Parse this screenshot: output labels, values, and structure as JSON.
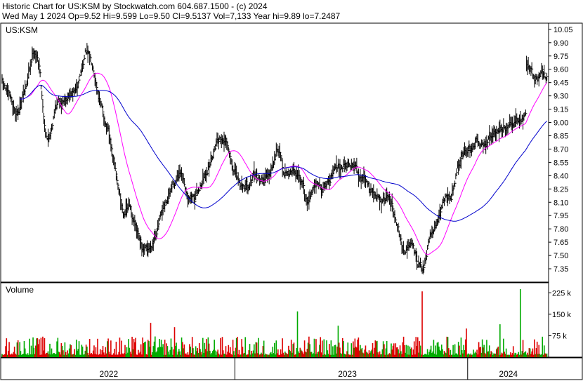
{
  "header": {
    "line1": "Historic Chart for US:KSM by Stockwatch.com 604.687.1500 - (c) 2024",
    "line2": "Wed May  1 2024   Op=9.52  Hi=9.599  Lo=9.50  Cl=9.5137  Vol=7,133  Year hi=9.89  lo=7.2487"
  },
  "chart_data": {
    "type": "line",
    "symbol": "US:KSM",
    "price_axis": {
      "ylim": [
        7.2,
        10.12
      ],
      "ticks": [
        "10.05",
        "9.90",
        "9.75",
        "9.60",
        "9.45",
        "9.30",
        "9.15",
        "9.00",
        "8.85",
        "8.70",
        "8.55",
        "8.40",
        "8.25",
        "8.10",
        "7.95",
        "7.80",
        "7.65",
        "7.50",
        "7.35"
      ]
    },
    "volume_axis": {
      "label": "Volume",
      "ylim": [
        0,
        260000
      ],
      "ticks": [
        "225 k",
        "150 k",
        "75 k"
      ],
      "tick_values": [
        225000,
        150000,
        75000
      ]
    },
    "x_axis": {
      "years": [
        "2022",
        "2023",
        "2024"
      ],
      "range_months": [
        0,
        28.1
      ],
      "year_start_months": [
        12,
        24
      ],
      "year_label_months": [
        5.5,
        17.8,
        26.1
      ]
    },
    "close_anchors": [
      [
        0.0,
        9.45
      ],
      [
        0.8,
        9.1
      ],
      [
        1.3,
        9.4
      ],
      [
        1.7,
        9.85
      ],
      [
        2.0,
        9.65
      ],
      [
        2.3,
        8.95
      ],
      [
        2.5,
        8.8
      ],
      [
        2.9,
        9.2
      ],
      [
        3.5,
        9.3
      ],
      [
        4.0,
        9.35
      ],
      [
        4.5,
        9.8
      ],
      [
        4.9,
        9.65
      ],
      [
        5.3,
        9.2
      ],
      [
        5.7,
        8.9
      ],
      [
        6.1,
        8.45
      ],
      [
        6.5,
        8.0
      ],
      [
        6.9,
        8.05
      ],
      [
        7.3,
        7.7
      ],
      [
        7.6,
        7.52
      ],
      [
        8.0,
        7.6
      ],
      [
        8.4,
        7.85
      ],
      [
        8.8,
        8.05
      ],
      [
        9.2,
        8.3
      ],
      [
        9.6,
        8.4
      ],
      [
        10.0,
        8.2
      ],
      [
        10.4,
        8.15
      ],
      [
        10.8,
        8.35
      ],
      [
        11.2,
        8.55
      ],
      [
        11.6,
        8.85
      ],
      [
        12.0,
        8.8
      ],
      [
        12.4,
        8.5
      ],
      [
        12.8,
        8.3
      ],
      [
        13.2,
        8.3
      ],
      [
        13.6,
        8.4
      ],
      [
        14.0,
        8.35
      ],
      [
        14.4,
        8.45
      ],
      [
        14.8,
        8.75
      ],
      [
        15.2,
        8.4
      ],
      [
        15.6,
        8.45
      ],
      [
        16.0,
        8.4
      ],
      [
        16.4,
        8.1
      ],
      [
        16.8,
        8.3
      ],
      [
        17.2,
        8.25
      ],
      [
        17.6,
        8.35
      ],
      [
        18.0,
        8.5
      ],
      [
        18.5,
        8.55
      ],
      [
        19.0,
        8.5
      ],
      [
        19.5,
        8.35
      ],
      [
        20.0,
        8.2
      ],
      [
        20.4,
        8.1
      ],
      [
        20.8,
        8.15
      ],
      [
        21.2,
        7.95
      ],
      [
        21.6,
        7.55
      ],
      [
        22.0,
        7.6
      ],
      [
        22.4,
        7.4
      ],
      [
        22.7,
        7.32
      ],
      [
        23.0,
        7.65
      ],
      [
        23.4,
        7.9
      ],
      [
        23.8,
        8.15
      ],
      [
        24.2,
        8.2
      ],
      [
        24.5,
        8.5
      ],
      [
        24.8,
        8.65
      ],
      [
        25.2,
        8.7
      ],
      [
        25.6,
        8.8
      ],
      [
        26.0,
        8.75
      ],
      [
        26.4,
        8.85
      ],
      [
        26.8,
        8.95
      ],
      [
        27.2,
        8.9
      ],
      [
        27.6,
        9.0
      ],
      [
        27.9,
        9.05
      ],
      [
        28.1,
        9.05
      ]
    ],
    "gap_jump": [
      [
        28.3,
        9.65
      ],
      [
        28.55,
        9.55
      ],
      [
        28.8,
        9.5
      ],
      [
        29.1,
        9.55
      ],
      [
        29.35,
        9.52
      ]
    ],
    "volume_spikes_k": [
      [
        22.6,
        230
      ],
      [
        25.0,
        100
      ],
      [
        26.8,
        115
      ],
      [
        27.9,
        238
      ],
      [
        15.9,
        160
      ],
      [
        18.1,
        110
      ],
      [
        8.0,
        120
      ],
      [
        9.3,
        105
      ]
    ],
    "moving_averages": [
      {
        "color": "#ff00ff",
        "period_days": 30
      },
      {
        "color": "#0000cc",
        "period_days": 100
      }
    ],
    "colors": {
      "bars": "#000000",
      "volume_up": "#00aa00",
      "volume_down": "#dd0000",
      "grid": "#000000"
    }
  }
}
